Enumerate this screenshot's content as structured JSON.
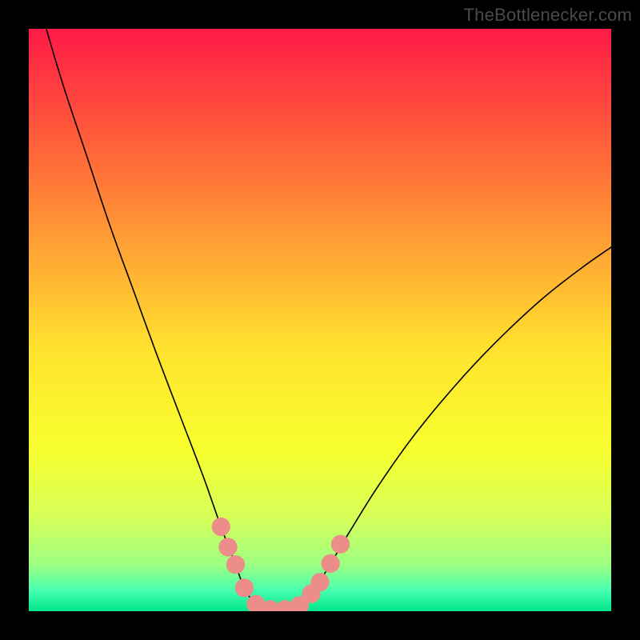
{
  "watermark": "TheBottlenecker.com",
  "chart_data": {
    "type": "line",
    "title": "",
    "xlabel": "",
    "ylabel": "",
    "xlim": [
      0,
      100
    ],
    "ylim": [
      0,
      100
    ],
    "gradient_stops": [
      {
        "offset": 0.0,
        "color": "#ff1a47"
      },
      {
        "offset": 0.18,
        "color": "#ff5a3a"
      },
      {
        "offset": 0.38,
        "color": "#ffa434"
      },
      {
        "offset": 0.55,
        "color": "#ffe22e"
      },
      {
        "offset": 0.72,
        "color": "#f8ff2e"
      },
      {
        "offset": 0.84,
        "color": "#d6ff59"
      },
      {
        "offset": 0.92,
        "color": "#9dff82"
      },
      {
        "offset": 0.965,
        "color": "#46ffb0"
      },
      {
        "offset": 1.0,
        "color": "#00e68c"
      }
    ],
    "series": [
      {
        "name": "bottleneck-curve",
        "points": [
          {
            "x": 3.0,
            "y": 100.0
          },
          {
            "x": 6.0,
            "y": 90.0
          },
          {
            "x": 10.0,
            "y": 78.0
          },
          {
            "x": 14.0,
            "y": 66.0
          },
          {
            "x": 18.0,
            "y": 55.0
          },
          {
            "x": 22.0,
            "y": 44.0
          },
          {
            "x": 26.0,
            "y": 33.5
          },
          {
            "x": 30.0,
            "y": 23.0
          },
          {
            "x": 33.0,
            "y": 14.5
          },
          {
            "x": 35.5,
            "y": 8.0
          },
          {
            "x": 37.0,
            "y": 4.0
          },
          {
            "x": 39.0,
            "y": 1.2
          },
          {
            "x": 41.5,
            "y": 0.3
          },
          {
            "x": 44.0,
            "y": 0.3
          },
          {
            "x": 46.5,
            "y": 1.0
          },
          {
            "x": 48.5,
            "y": 3.0
          },
          {
            "x": 51.0,
            "y": 6.8
          },
          {
            "x": 55.0,
            "y": 13.5
          },
          {
            "x": 60.0,
            "y": 21.5
          },
          {
            "x": 66.0,
            "y": 30.0
          },
          {
            "x": 73.0,
            "y": 38.5
          },
          {
            "x": 80.0,
            "y": 46.0
          },
          {
            "x": 88.0,
            "y": 53.5
          },
          {
            "x": 95.0,
            "y": 59.0
          },
          {
            "x": 100.0,
            "y": 62.5
          }
        ]
      }
    ],
    "markers": {
      "name": "highlight-dots",
      "color": "#ec8d89",
      "radius_pct": 1.6,
      "points": [
        {
          "x": 33.0,
          "y": 14.5
        },
        {
          "x": 34.2,
          "y": 11.0
        },
        {
          "x": 35.5,
          "y": 8.0
        },
        {
          "x": 37.0,
          "y": 4.0
        },
        {
          "x": 39.0,
          "y": 1.2
        },
        {
          "x": 41.5,
          "y": 0.3
        },
        {
          "x": 44.0,
          "y": 0.3
        },
        {
          "x": 46.5,
          "y": 1.0
        },
        {
          "x": 48.5,
          "y": 3.0
        },
        {
          "x": 50.0,
          "y": 5.0
        },
        {
          "x": 51.8,
          "y": 8.2
        },
        {
          "x": 53.5,
          "y": 11.5
        }
      ]
    }
  }
}
